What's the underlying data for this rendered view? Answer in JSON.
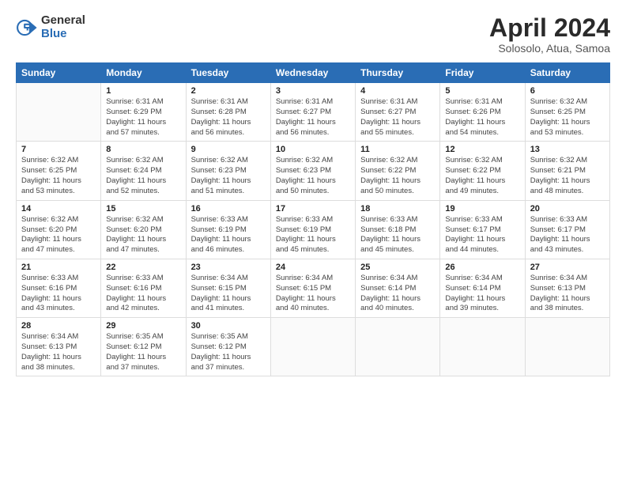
{
  "logo": {
    "general": "General",
    "blue": "Blue"
  },
  "title": "April 2024",
  "subtitle": "Solosolo, Atua, Samoa",
  "weekdays": [
    "Sunday",
    "Monday",
    "Tuesday",
    "Wednesday",
    "Thursday",
    "Friday",
    "Saturday"
  ],
  "weeks": [
    [
      {
        "day": "",
        "sunrise": "",
        "sunset": "",
        "daylight": ""
      },
      {
        "day": "1",
        "sunrise": "Sunrise: 6:31 AM",
        "sunset": "Sunset: 6:29 PM",
        "daylight": "Daylight: 11 hours and 57 minutes."
      },
      {
        "day": "2",
        "sunrise": "Sunrise: 6:31 AM",
        "sunset": "Sunset: 6:28 PM",
        "daylight": "Daylight: 11 hours and 56 minutes."
      },
      {
        "day": "3",
        "sunrise": "Sunrise: 6:31 AM",
        "sunset": "Sunset: 6:27 PM",
        "daylight": "Daylight: 11 hours and 56 minutes."
      },
      {
        "day": "4",
        "sunrise": "Sunrise: 6:31 AM",
        "sunset": "Sunset: 6:27 PM",
        "daylight": "Daylight: 11 hours and 55 minutes."
      },
      {
        "day": "5",
        "sunrise": "Sunrise: 6:31 AM",
        "sunset": "Sunset: 6:26 PM",
        "daylight": "Daylight: 11 hours and 54 minutes."
      },
      {
        "day": "6",
        "sunrise": "Sunrise: 6:32 AM",
        "sunset": "Sunset: 6:25 PM",
        "daylight": "Daylight: 11 hours and 53 minutes."
      }
    ],
    [
      {
        "day": "7",
        "sunrise": "Sunrise: 6:32 AM",
        "sunset": "Sunset: 6:25 PM",
        "daylight": "Daylight: 11 hours and 53 minutes."
      },
      {
        "day": "8",
        "sunrise": "Sunrise: 6:32 AM",
        "sunset": "Sunset: 6:24 PM",
        "daylight": "Daylight: 11 hours and 52 minutes."
      },
      {
        "day": "9",
        "sunrise": "Sunrise: 6:32 AM",
        "sunset": "Sunset: 6:23 PM",
        "daylight": "Daylight: 11 hours and 51 minutes."
      },
      {
        "day": "10",
        "sunrise": "Sunrise: 6:32 AM",
        "sunset": "Sunset: 6:23 PM",
        "daylight": "Daylight: 11 hours and 50 minutes."
      },
      {
        "day": "11",
        "sunrise": "Sunrise: 6:32 AM",
        "sunset": "Sunset: 6:22 PM",
        "daylight": "Daylight: 11 hours and 50 minutes."
      },
      {
        "day": "12",
        "sunrise": "Sunrise: 6:32 AM",
        "sunset": "Sunset: 6:22 PM",
        "daylight": "Daylight: 11 hours and 49 minutes."
      },
      {
        "day": "13",
        "sunrise": "Sunrise: 6:32 AM",
        "sunset": "Sunset: 6:21 PM",
        "daylight": "Daylight: 11 hours and 48 minutes."
      }
    ],
    [
      {
        "day": "14",
        "sunrise": "Sunrise: 6:32 AM",
        "sunset": "Sunset: 6:20 PM",
        "daylight": "Daylight: 11 hours and 47 minutes."
      },
      {
        "day": "15",
        "sunrise": "Sunrise: 6:32 AM",
        "sunset": "Sunset: 6:20 PM",
        "daylight": "Daylight: 11 hours and 47 minutes."
      },
      {
        "day": "16",
        "sunrise": "Sunrise: 6:33 AM",
        "sunset": "Sunset: 6:19 PM",
        "daylight": "Daylight: 11 hours and 46 minutes."
      },
      {
        "day": "17",
        "sunrise": "Sunrise: 6:33 AM",
        "sunset": "Sunset: 6:19 PM",
        "daylight": "Daylight: 11 hours and 45 minutes."
      },
      {
        "day": "18",
        "sunrise": "Sunrise: 6:33 AM",
        "sunset": "Sunset: 6:18 PM",
        "daylight": "Daylight: 11 hours and 45 minutes."
      },
      {
        "day": "19",
        "sunrise": "Sunrise: 6:33 AM",
        "sunset": "Sunset: 6:17 PM",
        "daylight": "Daylight: 11 hours and 44 minutes."
      },
      {
        "day": "20",
        "sunrise": "Sunrise: 6:33 AM",
        "sunset": "Sunset: 6:17 PM",
        "daylight": "Daylight: 11 hours and 43 minutes."
      }
    ],
    [
      {
        "day": "21",
        "sunrise": "Sunrise: 6:33 AM",
        "sunset": "Sunset: 6:16 PM",
        "daylight": "Daylight: 11 hours and 43 minutes."
      },
      {
        "day": "22",
        "sunrise": "Sunrise: 6:33 AM",
        "sunset": "Sunset: 6:16 PM",
        "daylight": "Daylight: 11 hours and 42 minutes."
      },
      {
        "day": "23",
        "sunrise": "Sunrise: 6:34 AM",
        "sunset": "Sunset: 6:15 PM",
        "daylight": "Daylight: 11 hours and 41 minutes."
      },
      {
        "day": "24",
        "sunrise": "Sunrise: 6:34 AM",
        "sunset": "Sunset: 6:15 PM",
        "daylight": "Daylight: 11 hours and 40 minutes."
      },
      {
        "day": "25",
        "sunrise": "Sunrise: 6:34 AM",
        "sunset": "Sunset: 6:14 PM",
        "daylight": "Daylight: 11 hours and 40 minutes."
      },
      {
        "day": "26",
        "sunrise": "Sunrise: 6:34 AM",
        "sunset": "Sunset: 6:14 PM",
        "daylight": "Daylight: 11 hours and 39 minutes."
      },
      {
        "day": "27",
        "sunrise": "Sunrise: 6:34 AM",
        "sunset": "Sunset: 6:13 PM",
        "daylight": "Daylight: 11 hours and 38 minutes."
      }
    ],
    [
      {
        "day": "28",
        "sunrise": "Sunrise: 6:34 AM",
        "sunset": "Sunset: 6:13 PM",
        "daylight": "Daylight: 11 hours and 38 minutes."
      },
      {
        "day": "29",
        "sunrise": "Sunrise: 6:35 AM",
        "sunset": "Sunset: 6:12 PM",
        "daylight": "Daylight: 11 hours and 37 minutes."
      },
      {
        "day": "30",
        "sunrise": "Sunrise: 6:35 AM",
        "sunset": "Sunset: 6:12 PM",
        "daylight": "Daylight: 11 hours and 37 minutes."
      },
      {
        "day": "",
        "sunrise": "",
        "sunset": "",
        "daylight": ""
      },
      {
        "day": "",
        "sunrise": "",
        "sunset": "",
        "daylight": ""
      },
      {
        "day": "",
        "sunrise": "",
        "sunset": "",
        "daylight": ""
      },
      {
        "day": "",
        "sunrise": "",
        "sunset": "",
        "daylight": ""
      }
    ]
  ]
}
